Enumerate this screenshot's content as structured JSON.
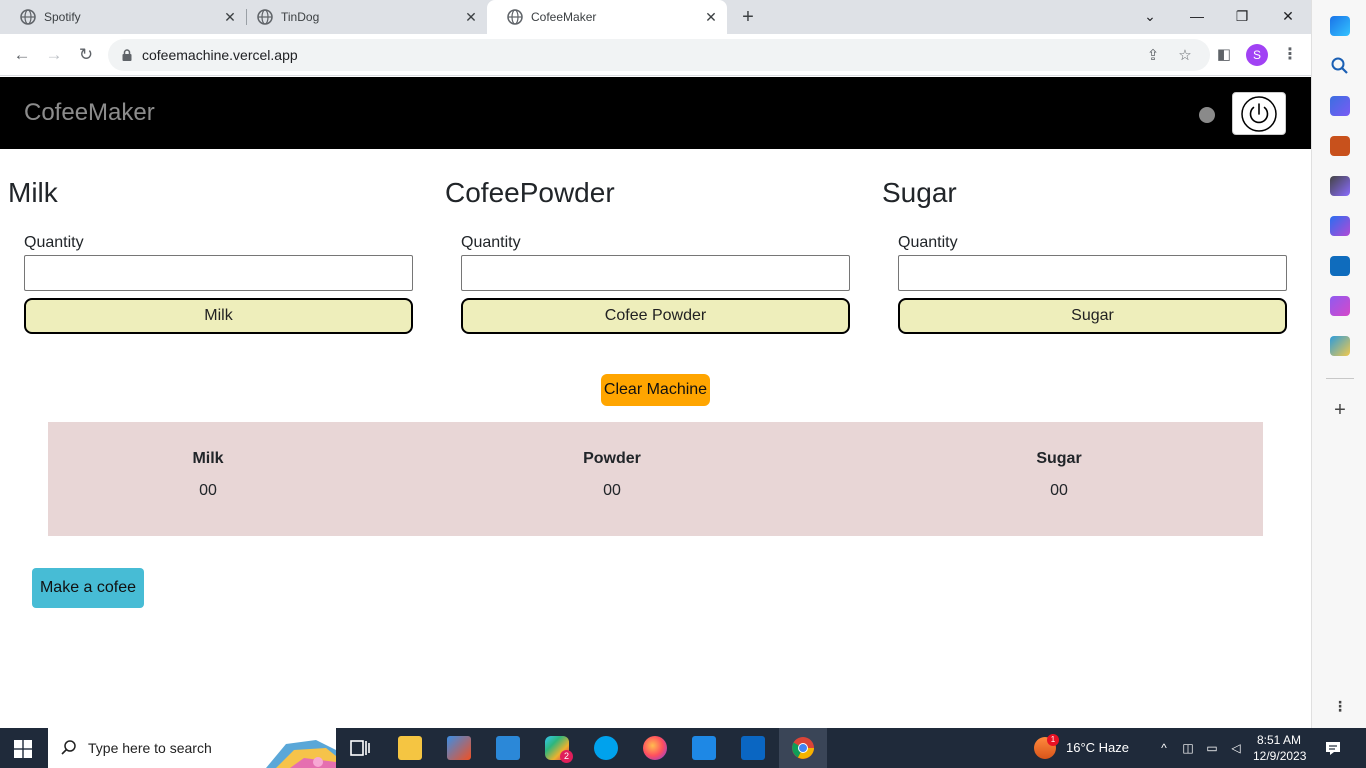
{
  "browser": {
    "tabs": [
      {
        "title": "Spotify",
        "active": false
      },
      {
        "title": "TinDog",
        "active": false
      },
      {
        "title": "CofeeMaker",
        "active": true
      }
    ],
    "url": "cofeemachine.vercel.app",
    "profile_initial": "S"
  },
  "app": {
    "brand": "CofeeMaker",
    "ingredients": [
      {
        "heading": "Milk",
        "quantity_label": "Quantity",
        "quantity_value": "",
        "button_label": "Milk"
      },
      {
        "heading": "CofeePowder",
        "quantity_label": "Quantity",
        "quantity_value": "",
        "button_label": "Cofee Powder"
      },
      {
        "heading": "Sugar",
        "quantity_label": "Quantity",
        "quantity_value": "",
        "button_label": "Sugar"
      }
    ],
    "clear_label": "Clear Machine",
    "summary": [
      {
        "label": "Milk",
        "value": "00"
      },
      {
        "label": "Powder",
        "value": "00"
      },
      {
        "label": "Sugar",
        "value": "00"
      }
    ],
    "make_label": "Make a cofee"
  },
  "taskbar": {
    "search_placeholder": "Type here to search",
    "weather": "16°C  Haze",
    "weather_badge": "1",
    "slack_badge": "2",
    "time": "8:51 AM",
    "date": "12/9/2023"
  },
  "colors": {
    "navbar": "#000000",
    "ingredient_button": "#eeeebb",
    "clear_button": "#ffa500",
    "summary_bg": "#e8d6d6",
    "make_button": "#47bcd5"
  }
}
